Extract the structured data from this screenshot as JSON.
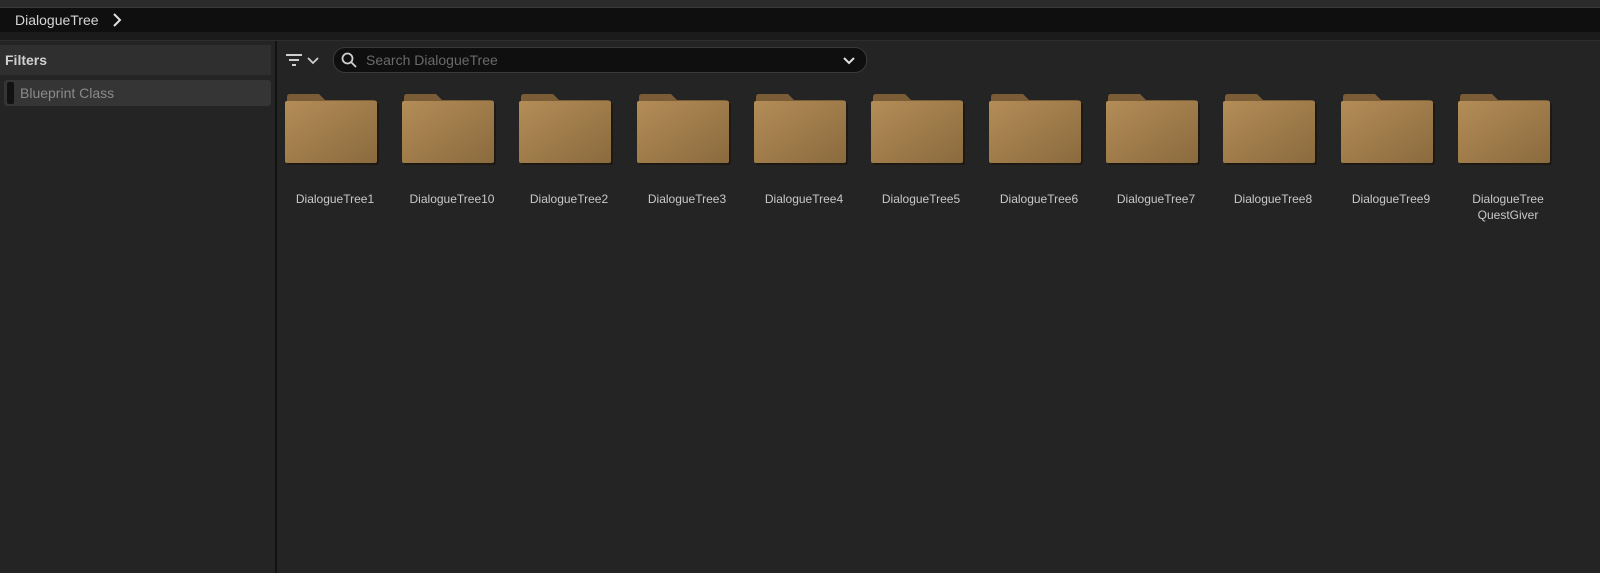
{
  "breadcrumb": {
    "path_label": "DialogueTree",
    "chevron_icon": "chevron-right-icon"
  },
  "filters": {
    "title": "Filters",
    "items": [
      {
        "label": "Blueprint Class"
      }
    ]
  },
  "toolbar": {
    "filter_icon": "filter-lines-icon",
    "search": {
      "placeholder": "Search DialogueTree",
      "value": "",
      "icon": "search-icon",
      "dropdown_icon": "chevron-down-icon"
    }
  },
  "folders": [
    {
      "line1": "DialogueTree1",
      "line2": ""
    },
    {
      "line1": "DialogueTree10",
      "line2": ""
    },
    {
      "line1": "DialogueTree2",
      "line2": ""
    },
    {
      "line1": "DialogueTree3",
      "line2": ""
    },
    {
      "line1": "DialogueTree4",
      "line2": ""
    },
    {
      "line1": "DialogueTree5",
      "line2": ""
    },
    {
      "line1": "DialogueTree6",
      "line2": ""
    },
    {
      "line1": "DialogueTree7",
      "line2": ""
    },
    {
      "line1": "DialogueTree8",
      "line2": ""
    },
    {
      "line1": "DialogueTree9",
      "line2": ""
    },
    {
      "line1": "DialogueTree",
      "line2": "QuestGiver"
    }
  ],
  "colors": {
    "folder_light": "#b48d57",
    "folder_dark": "#8a6a3e",
    "folder_tab": "#7a5d36",
    "background": "#242424"
  }
}
